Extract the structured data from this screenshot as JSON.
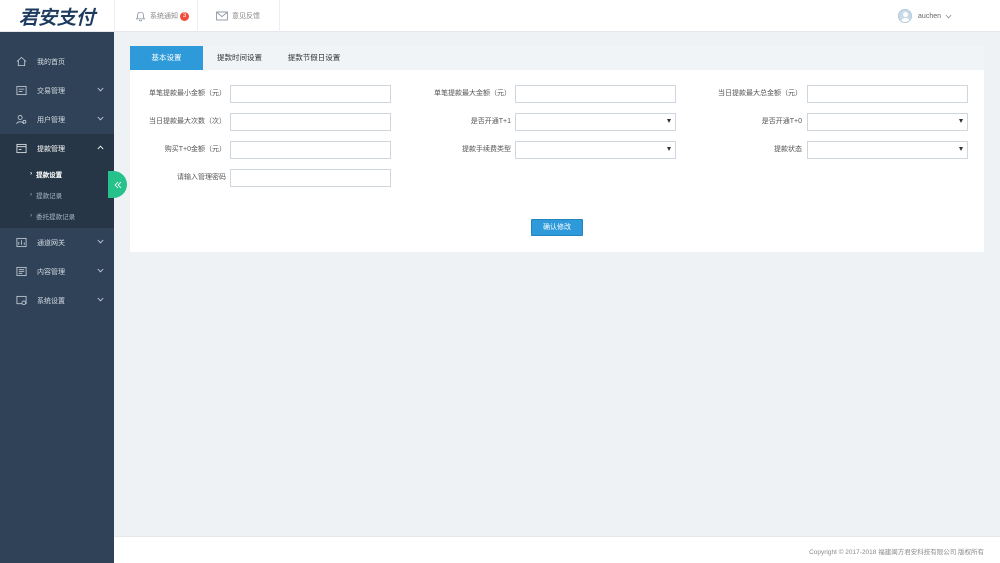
{
  "app": {
    "logo_text": "君安支付"
  },
  "header": {
    "notify_label": "系统通知",
    "notify_count": "3",
    "feedback_label": "意见反馈",
    "username": "auchen"
  },
  "sidebar": {
    "items": [
      {
        "label": "我的首页",
        "icon": "home-icon"
      },
      {
        "label": "交易管理",
        "icon": "trade-icon"
      },
      {
        "label": "用户管理",
        "icon": "users-icon"
      },
      {
        "label": "提款管理",
        "icon": "withdraw-icon"
      },
      {
        "label": "通道网关",
        "icon": "gateway-icon"
      },
      {
        "label": "内容管理",
        "icon": "content-icon"
      },
      {
        "label": "系统设置",
        "icon": "settings-icon"
      }
    ],
    "submenu": [
      {
        "label": "提款设置",
        "active": true
      },
      {
        "label": "提款记录",
        "active": false
      },
      {
        "label": "委托提款记录",
        "active": false
      }
    ]
  },
  "tabs": [
    {
      "label": "基本设置",
      "active": true
    },
    {
      "label": "提款时间设置",
      "active": false
    },
    {
      "label": "提款节假日设置",
      "active": false
    }
  ],
  "form": {
    "fields": [
      {
        "label": "单笔提款最小金额（元）",
        "type": "input",
        "value": ""
      },
      {
        "label": "单笔提款最大金额（元）",
        "type": "input",
        "value": ""
      },
      {
        "label": "当日提款最大总金额（元）",
        "type": "input",
        "value": ""
      },
      {
        "label": "当日提款最大次数（次）",
        "type": "input",
        "value": ""
      },
      {
        "label": "是否开通T+1",
        "type": "select",
        "value": ""
      },
      {
        "label": "是否开通T+0",
        "type": "select",
        "value": ""
      },
      {
        "label": "购买T+0金额（元）",
        "type": "input",
        "value": ""
      },
      {
        "label": "提款手续费类型",
        "type": "select",
        "value": ""
      },
      {
        "label": "提款状态",
        "type": "select",
        "value": ""
      },
      {
        "label": "请输入管理密码",
        "type": "input",
        "value": ""
      }
    ],
    "submit_label": "确认修改"
  },
  "footer": {
    "copyright": "Copyright © 2017-2018 福建闽方君安科技有限公司 版权所有"
  },
  "colors": {
    "sidebar_bg": "#2f4257",
    "accent": "#2e9ad9",
    "collapse_button": "#27c28b",
    "badge": "#f04d3a"
  }
}
